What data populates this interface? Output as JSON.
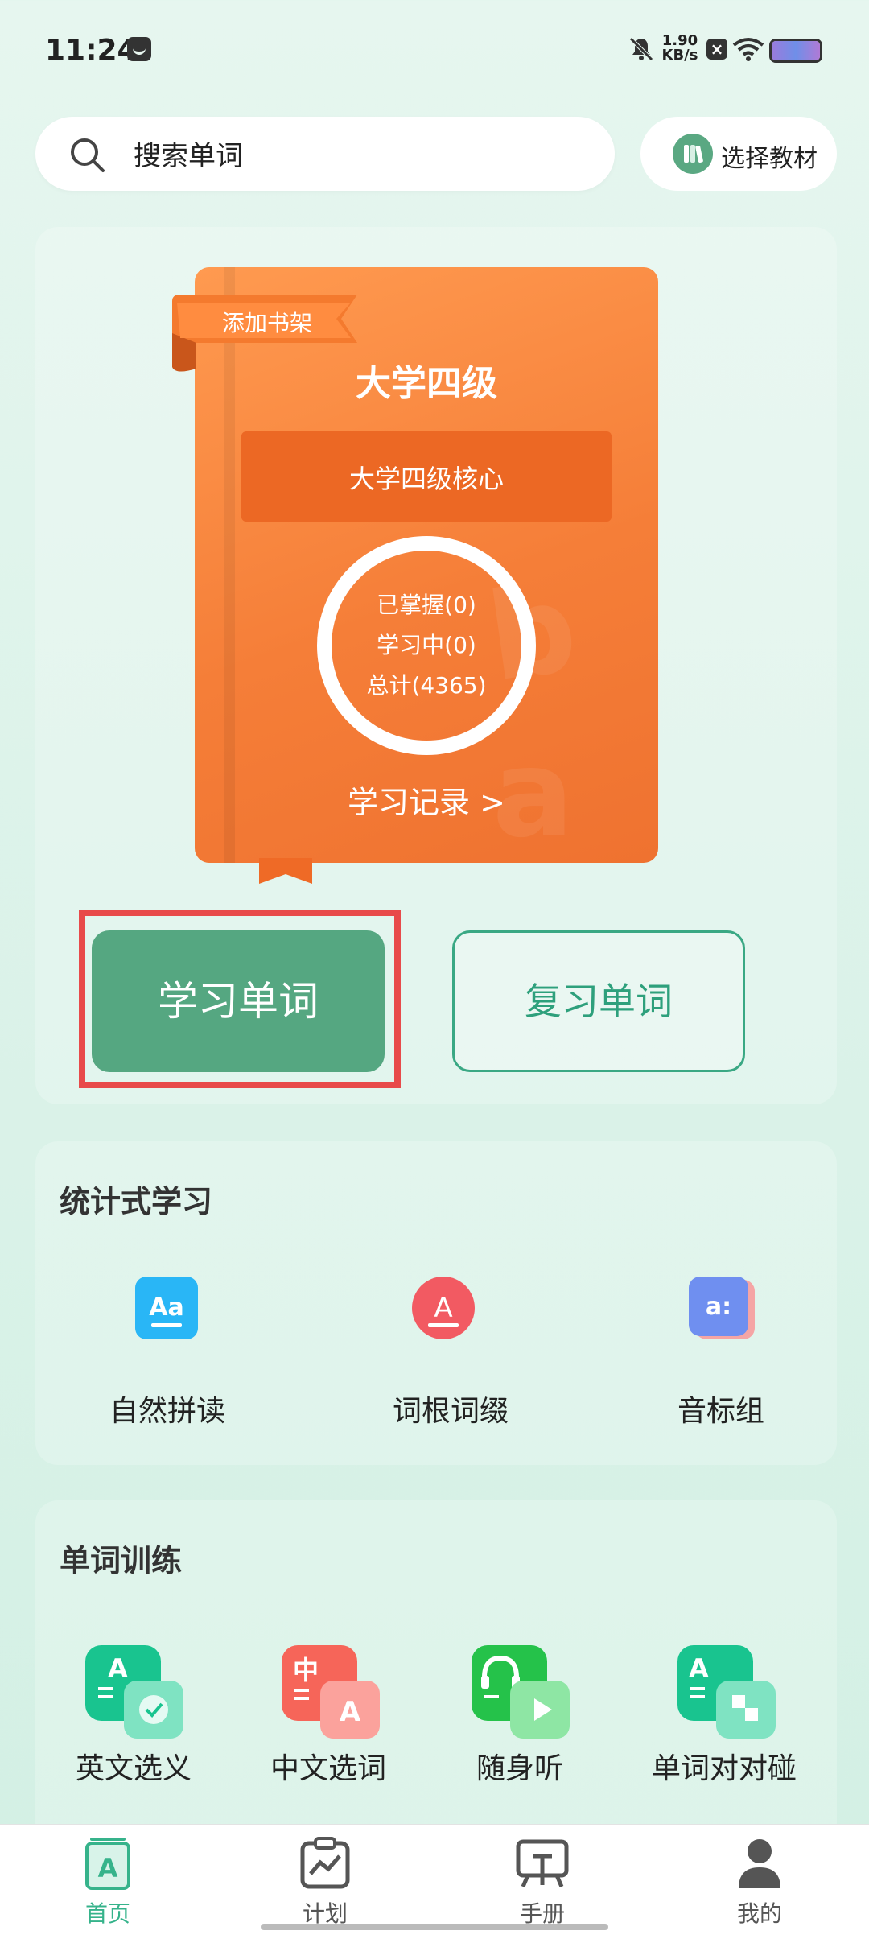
{
  "status_bar": {
    "time": "11:24",
    "net_speed_value": "1.90",
    "net_speed_unit": "KB/s"
  },
  "search": {
    "placeholder": "搜索单词"
  },
  "select_textbook": {
    "label": "选择教材"
  },
  "book": {
    "tag": "添加书架",
    "title": "大学四级",
    "subtitle": "大学四级核心",
    "mastered": "已掌握(0)",
    "learning": "学习中(0)",
    "total": "总计(4365)",
    "record_link": "学习记录 >"
  },
  "actions": {
    "learn": "学习单词",
    "review": "复习单词"
  },
  "stats_section": {
    "title": "统计式学习",
    "items": [
      {
        "label": "自然拼读",
        "icon": "aa-icon",
        "glyph": "Aa",
        "color": "#29b6f6"
      },
      {
        "label": "词根词缀",
        "icon": "root-a-icon",
        "glyph": "A",
        "color": "#f25a62"
      },
      {
        "label": "音标组",
        "icon": "phonetic-icon",
        "glyph": "a:",
        "color": "#6f8ff0"
      }
    ]
  },
  "training_section": {
    "title": "单词训练",
    "items": [
      {
        "label": "英文选义",
        "icon": "english-choice-icon",
        "glyph": "A",
        "color": "#19c48f"
      },
      {
        "label": "中文选词",
        "icon": "chinese-choice-icon",
        "glyph": "中",
        "color": "#f66559"
      },
      {
        "label": "随身听",
        "icon": "headphones-icon",
        "glyph": "♪",
        "color": "#25c24a"
      },
      {
        "label": "单词对对碰",
        "icon": "match-icon",
        "glyph": "A",
        "color": "#19c48f"
      }
    ]
  },
  "nav": {
    "items": [
      {
        "label": "首页",
        "icon": "home-a-icon",
        "active": true
      },
      {
        "label": "计划",
        "icon": "plan-icon",
        "active": false
      },
      {
        "label": "手册",
        "icon": "manual-icon",
        "active": false
      },
      {
        "label": "我的",
        "icon": "profile-icon",
        "active": false
      }
    ],
    "active_color": "#36b38b"
  }
}
